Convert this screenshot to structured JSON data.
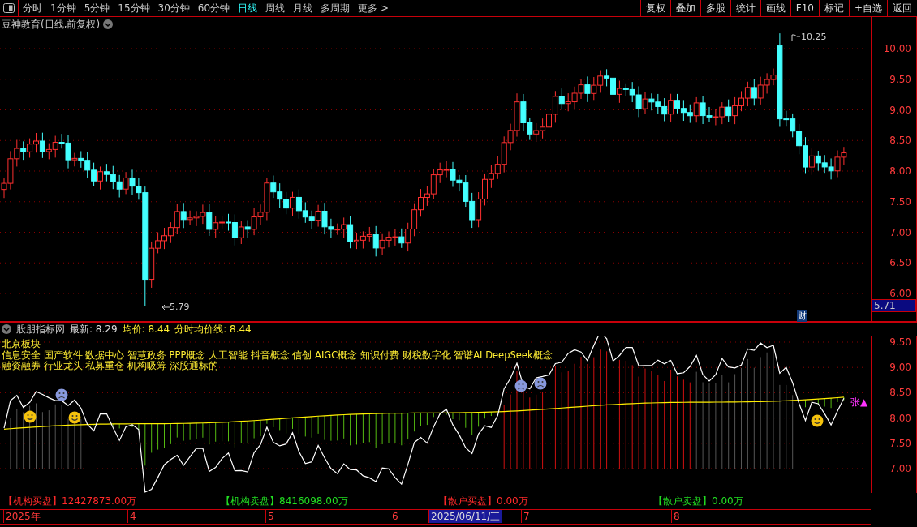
{
  "toolbar": {
    "periods": [
      {
        "label": "分时",
        "selected": false
      },
      {
        "label": "1分钟",
        "selected": false
      },
      {
        "label": "5分钟",
        "selected": false
      },
      {
        "label": "15分钟",
        "selected": false
      },
      {
        "label": "30分钟",
        "selected": false
      },
      {
        "label": "60分钟",
        "selected": false
      },
      {
        "label": "日线",
        "selected": true
      },
      {
        "label": "周线",
        "selected": false
      },
      {
        "label": "月线",
        "selected": false
      },
      {
        "label": "多周期",
        "selected": false
      },
      {
        "label": "更多 >",
        "selected": false
      }
    ],
    "buttons": [
      "复权",
      "叠加",
      "多股",
      "统计",
      "画线",
      "F10",
      "标记",
      "+自选",
      "返回"
    ]
  },
  "main_chart": {
    "title": "豆神教育(日线,前复权)",
    "y_ticks": [
      "10.00",
      "9.50",
      "9.00",
      "8.50",
      "8.00",
      "7.50",
      "7.00",
      "6.50",
      "6.00"
    ],
    "high_label": "10.25",
    "low_label": "5.79",
    "current_price": "5.71",
    "badge": "财"
  },
  "indicator": {
    "name": "股朋指标网",
    "stats": [
      {
        "text": "最新: 8.29",
        "kind": "latest"
      },
      {
        "text": "均价: 8.44",
        "kind": "average"
      },
      {
        "text": "分时均价线: 8.44",
        "kind": "average"
      }
    ],
    "sector_title": "北京板块",
    "concept_lines": [
      "信息安全 国产软件 数据中心 智慧政务 PPP概念 人工智能 抖音概念 信创 AIGC概念 知识付费 财税数字化 智谱AI DeepSeek概念",
      "融资融券 行业龙头 私募重仓 机构吸筹 深股通标的"
    ],
    "rise_mark": "张▲",
    "y_ticks": [
      "9.50",
      "9.00",
      "8.50",
      "8.00",
      "7.50",
      "7.00"
    ]
  },
  "flows": [
    {
      "text": "【机构买盘】12427873.00万",
      "kind": "buy"
    },
    {
      "text": "【机构卖盘】8416098.00万",
      "kind": "sell"
    },
    {
      "text": "【散户买盘】0.00万",
      "kind": "buy"
    },
    {
      "text": "【散户卖盘】0.00万",
      "kind": "sell"
    }
  ],
  "date_axis": [
    {
      "label": "2025年",
      "selected": false
    },
    {
      "label": "4",
      "selected": false
    },
    {
      "label": "5",
      "selected": false
    },
    {
      "label": "6",
      "selected": false
    },
    {
      "label": "2025/06/11/三",
      "selected": true
    },
    {
      "label": "7",
      "selected": false
    },
    {
      "label": "8",
      "selected": false
    }
  ]
}
